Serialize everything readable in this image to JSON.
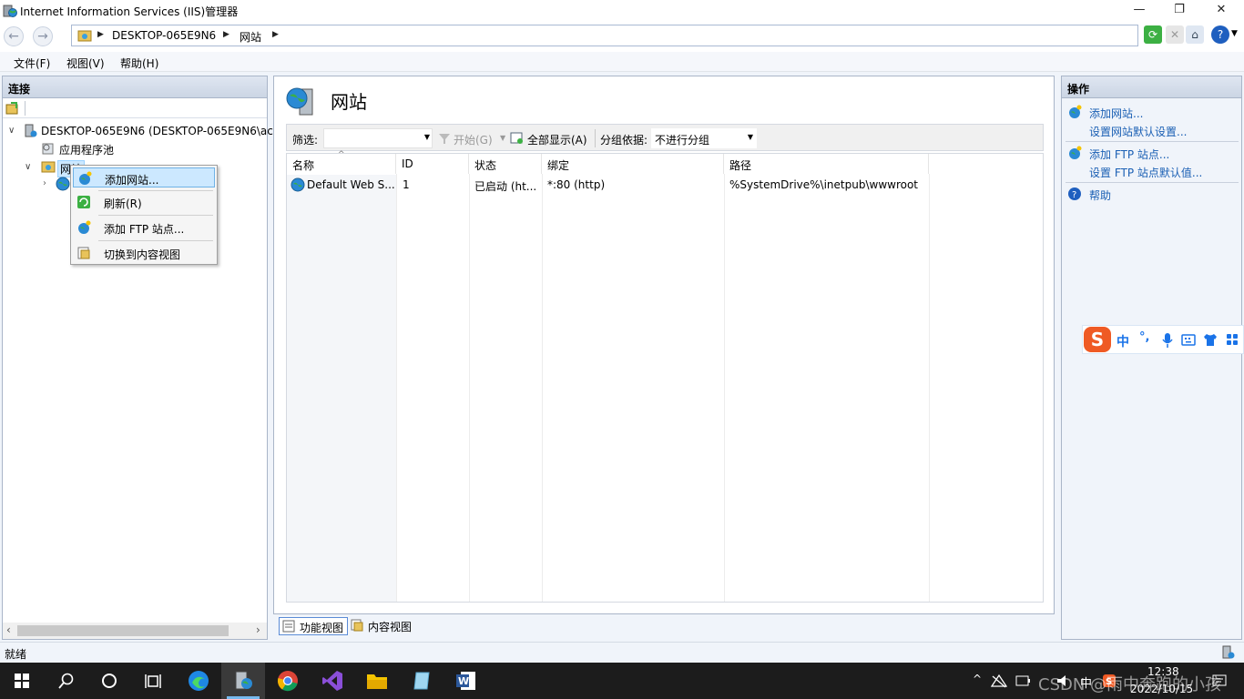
{
  "window": {
    "title": "Internet Information Services (IIS)管理器",
    "minimize": "—",
    "restore": "❐",
    "close": "✕"
  },
  "address": {
    "segments": [
      "DESKTOP-065E9N6",
      "网站"
    ]
  },
  "menu": [
    "文件(F)",
    "视图(V)",
    "帮助(H)"
  ],
  "left_panel": {
    "header": "连接",
    "tree": {
      "server": "DESKTOP-065E9N6 (DESKTOP-065E9N6\\ac",
      "app_pools": "应用程序池",
      "sites": "网站"
    }
  },
  "context_menu": {
    "items": [
      "添加网站...",
      "刷新(R)",
      "添加 FTP 站点...",
      "切换到内容视图"
    ]
  },
  "center": {
    "title": "网站",
    "filter_label": "筛选:",
    "start_label": "开始(G)",
    "show_all_label": "全部显示(A)",
    "group_by_label": "分组依据:",
    "group_by_value": "不进行分组",
    "columns": [
      "名称",
      "ID",
      "状态",
      "绑定",
      "路径"
    ],
    "rows": [
      {
        "name": "Default Web S...",
        "id": "1",
        "status": "已启动 (ht...",
        "binding": "*:80 (http)",
        "path": "%SystemDrive%\\inetpub\\wwwroot"
      }
    ],
    "view_tabs": [
      "功能视图",
      "内容视图"
    ]
  },
  "right_panel": {
    "header": "操作",
    "actions": [
      "添加网站...",
      "设置网站默认设置...",
      "添加 FTP 站点...",
      "设置 FTP 站点默认值...",
      "帮助"
    ]
  },
  "status": {
    "text": "就绪"
  },
  "ime": {
    "lang": "中",
    "punct": "°,"
  },
  "taskbar": {
    "time": "12:38",
    "date": "2022/10/15",
    "ime_indicator": "中",
    "watermark": "CSDN @雨中奔跑的小孩"
  },
  "colors": {
    "accent": "#1a5fb4",
    "panel_border": "#a9b5c8",
    "selection": "#cce8ff"
  }
}
